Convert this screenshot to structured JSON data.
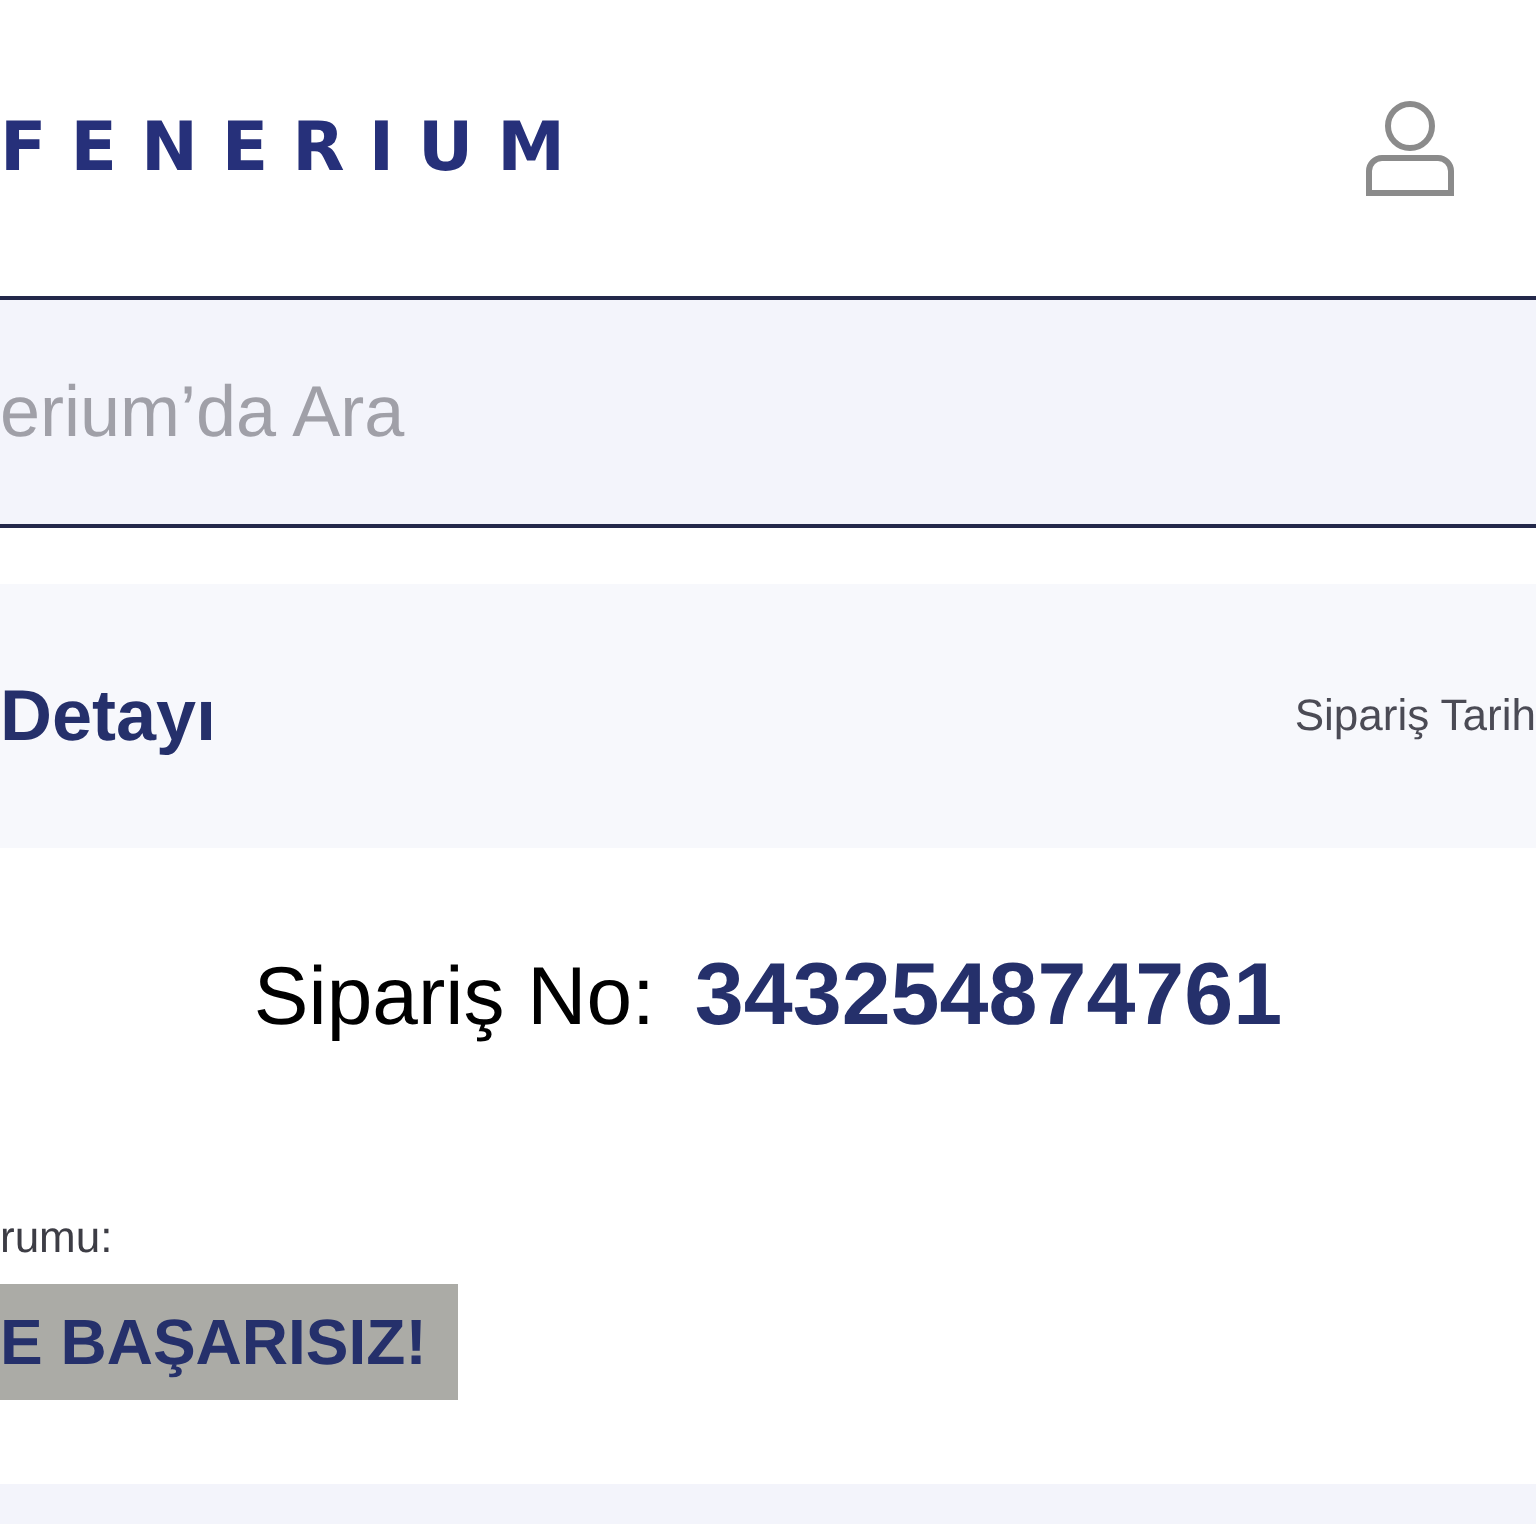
{
  "header": {
    "logo": "FENERIUM"
  },
  "search": {
    "placeholder": "erium’da Ara"
  },
  "order_panel": {
    "title": "Detayı",
    "date_label": "Sipariş Tarih"
  },
  "order_number": {
    "label": "Sipariş No:",
    "value": "343254874761"
  },
  "status": {
    "label": "rumu:",
    "badge": "E BAŞARISIZ!"
  }
}
